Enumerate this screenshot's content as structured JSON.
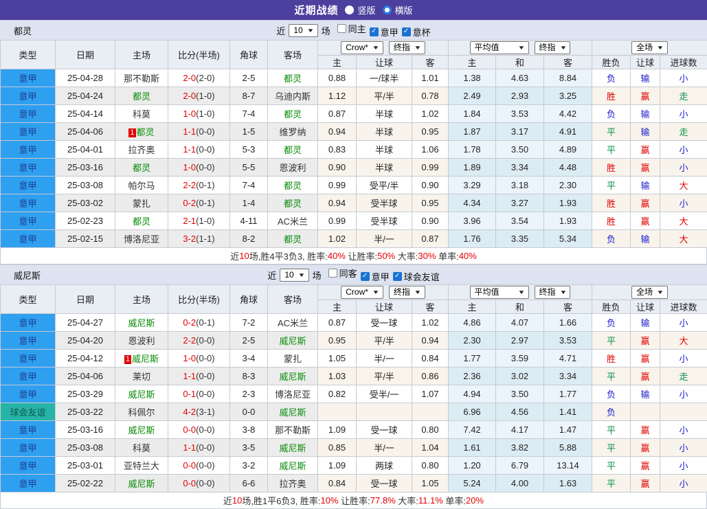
{
  "titlebar": {
    "title": "近期战绩",
    "radios": [
      {
        "label": "竖版",
        "selected": false
      },
      {
        "label": "横版",
        "selected": true
      }
    ]
  },
  "colors": {
    "titlebar_purple": "#4c3f9e",
    "league_blue": "#2f9ff0",
    "friendly_teal": "#27b4a8",
    "win_red": "#e30000",
    "lose_blue": "#1a1acc",
    "draw_green": "#089148",
    "hot_team_green": "#088b08",
    "avg_col_tint": "#ebf4fa"
  },
  "filter_words": {
    "near": "近",
    "games": "场"
  },
  "columns": {
    "type": "类型",
    "date": "日期",
    "home": "主场",
    "score": "比分(半场)",
    "corner": "角球",
    "away": "客场",
    "dd_crow": "Crow*",
    "dd_final": "终指",
    "dd_avg": "平均值",
    "dd_full": "全场",
    "sub": [
      "主",
      "让球",
      "客",
      "主",
      "和",
      "客",
      "胜负",
      "让球",
      "进球数"
    ]
  },
  "sections": [
    {
      "team": "都灵",
      "filter": {
        "count": "10",
        "checks": [
          {
            "label": "同主",
            "state": "unchecked"
          },
          {
            "label": "意甲",
            "state": "checked"
          },
          {
            "label": "意杯",
            "state": "checked"
          }
        ]
      },
      "rows": [
        {
          "type": "意甲",
          "typeKind": "league",
          "date": "25-04-28",
          "badge": "",
          "home": "那不勒斯",
          "homeClass": "",
          "score": "2-0",
          "half": "(2-0)",
          "corner": "2-5",
          "away": "都灵",
          "awayClass": "hot",
          "o1": "0.88",
          "hcap": "一/球半",
          "o2": "1.01",
          "a1": "1.38",
          "a2": "4.63",
          "a3": "8.84",
          "r1": "负",
          "r1k": "lose",
          "r2": "输",
          "r2k": "lose",
          "r3": "小",
          "r3k": "lose"
        },
        {
          "type": "意甲",
          "typeKind": "league",
          "date": "25-04-24",
          "badge": "",
          "home": "都灵",
          "homeClass": "hot",
          "score": "2-0",
          "half": "(1-0)",
          "corner": "8-7",
          "away": "乌迪内斯",
          "awayClass": "",
          "o1": "1.12",
          "hcap": "平/半",
          "o2": "0.78",
          "a1": "2.49",
          "a2": "2.93",
          "a3": "3.25",
          "r1": "胜",
          "r1k": "win",
          "r2": "赢",
          "r2k": "win",
          "r3": "走",
          "r3k": "draw"
        },
        {
          "type": "意甲",
          "typeKind": "league",
          "date": "25-04-14",
          "badge": "",
          "home": "科莫",
          "homeClass": "",
          "score": "1-0",
          "half": "(1-0)",
          "corner": "7-4",
          "away": "都灵",
          "awayClass": "hot",
          "o1": "0.87",
          "hcap": "半球",
          "o2": "1.02",
          "a1": "1.84",
          "a2": "3.53",
          "a3": "4.42",
          "r1": "负",
          "r1k": "lose",
          "r2": "输",
          "r2k": "lose",
          "r3": "小",
          "r3k": "lose"
        },
        {
          "type": "意甲",
          "typeKind": "league",
          "date": "25-04-06",
          "badge": "1",
          "home": "都灵",
          "homeClass": "hot",
          "score": "1-1",
          "half": "(0-0)",
          "corner": "1-5",
          "away": "维罗纳",
          "awayClass": "",
          "o1": "0.94",
          "hcap": "半球",
          "o2": "0.95",
          "a1": "1.87",
          "a2": "3.17",
          "a3": "4.91",
          "r1": "平",
          "r1k": "draw",
          "r2": "输",
          "r2k": "lose",
          "r3": "走",
          "r3k": "draw"
        },
        {
          "type": "意甲",
          "typeKind": "league",
          "date": "25-04-01",
          "badge": "",
          "home": "拉齐奥",
          "homeClass": "",
          "score": "1-1",
          "half": "(0-0)",
          "corner": "5-3",
          "away": "都灵",
          "awayClass": "hot",
          "o1": "0.83",
          "hcap": "半球",
          "o2": "1.06",
          "a1": "1.78",
          "a2": "3.50",
          "a3": "4.89",
          "r1": "平",
          "r1k": "draw",
          "r2": "赢",
          "r2k": "win",
          "r3": "小",
          "r3k": "lose"
        },
        {
          "type": "意甲",
          "typeKind": "league",
          "date": "25-03-16",
          "badge": "",
          "home": "都灵",
          "homeClass": "hot",
          "score": "1-0",
          "half": "(0-0)",
          "corner": "5-5",
          "away": "恩波利",
          "awayClass": "",
          "o1": "0.90",
          "hcap": "半球",
          "o2": "0.99",
          "a1": "1.89",
          "a2": "3.34",
          "a3": "4.48",
          "r1": "胜",
          "r1k": "win",
          "r2": "赢",
          "r2k": "win",
          "r3": "小",
          "r3k": "lose"
        },
        {
          "type": "意甲",
          "typeKind": "league",
          "date": "25-03-08",
          "badge": "",
          "home": "帕尔马",
          "homeClass": "",
          "score": "2-2",
          "half": "(0-1)",
          "corner": "7-4",
          "away": "都灵",
          "awayClass": "hot",
          "o1": "0.99",
          "hcap": "受平/半",
          "o2": "0.90",
          "a1": "3.29",
          "a2": "3.18",
          "a3": "2.30",
          "r1": "平",
          "r1k": "draw",
          "r2": "输",
          "r2k": "lose",
          "r3": "大",
          "r3k": "win"
        },
        {
          "type": "意甲",
          "typeKind": "league",
          "date": "25-03-02",
          "badge": "",
          "home": "蒙扎",
          "homeClass": "",
          "score": "0-2",
          "half": "(0-1)",
          "corner": "1-4",
          "away": "都灵",
          "awayClass": "hot",
          "o1": "0.94",
          "hcap": "受半球",
          "o2": "0.95",
          "a1": "4.34",
          "a2": "3.27",
          "a3": "1.93",
          "r1": "胜",
          "r1k": "win",
          "r2": "赢",
          "r2k": "win",
          "r3": "小",
          "r3k": "lose"
        },
        {
          "type": "意甲",
          "typeKind": "league",
          "date": "25-02-23",
          "badge": "",
          "home": "都灵",
          "homeClass": "hot",
          "score": "2-1",
          "half": "(1-0)",
          "corner": "4-11",
          "away": "AC米兰",
          "awayClass": "",
          "o1": "0.99",
          "hcap": "受半球",
          "o2": "0.90",
          "a1": "3.96",
          "a2": "3.54",
          "a3": "1.93",
          "r1": "胜",
          "r1k": "win",
          "r2": "赢",
          "r2k": "win",
          "r3": "大",
          "r3k": "win"
        },
        {
          "type": "意甲",
          "typeKind": "league",
          "date": "25-02-15",
          "badge": "",
          "home": "博洛尼亚",
          "homeClass": "",
          "score": "3-2",
          "half": "(1-1)",
          "corner": "8-2",
          "away": "都灵",
          "awayClass": "hot",
          "o1": "1.02",
          "hcap": "半/一",
          "o2": "0.87",
          "a1": "1.76",
          "a2": "3.35",
          "a3": "5.34",
          "r1": "负",
          "r1k": "lose",
          "r2": "输",
          "r2k": "lose",
          "r3": "大",
          "r3k": "win"
        }
      ],
      "summary": [
        {
          "t": "近",
          "c": ""
        },
        {
          "t": "10",
          "c": "r"
        },
        {
          "t": "场,胜4平3负3, 胜率:",
          "c": ""
        },
        {
          "t": "40%",
          "c": "r"
        },
        {
          "t": " 让胜率:",
          "c": ""
        },
        {
          "t": "50%",
          "c": "r"
        },
        {
          "t": " 大率:",
          "c": ""
        },
        {
          "t": "30%",
          "c": "r"
        },
        {
          "t": " 单率:",
          "c": ""
        },
        {
          "t": "40%",
          "c": "r"
        }
      ]
    },
    {
      "team": "威尼斯",
      "filter": {
        "count": "10",
        "checks": [
          {
            "label": "同客",
            "state": "unchecked"
          },
          {
            "label": "意甲",
            "state": "checked"
          },
          {
            "label": "球会友谊",
            "state": "checked"
          }
        ]
      },
      "rows": [
        {
          "type": "意甲",
          "typeKind": "league",
          "date": "25-04-27",
          "badge": "",
          "home": "威尼斯",
          "homeClass": "hot",
          "score": "0-2",
          "half": "(0-1)",
          "corner": "7-2",
          "away": "AC米兰",
          "awayClass": "",
          "o1": "0.87",
          "hcap": "受一球",
          "o2": "1.02",
          "a1": "4.86",
          "a2": "4.07",
          "a3": "1.66",
          "r1": "负",
          "r1k": "lose",
          "r2": "输",
          "r2k": "lose",
          "r3": "小",
          "r3k": "lose"
        },
        {
          "type": "意甲",
          "typeKind": "league",
          "date": "25-04-20",
          "badge": "",
          "home": "恩波利",
          "homeClass": "",
          "score": "2-2",
          "half": "(0-0)",
          "corner": "2-5",
          "away": "威尼斯",
          "awayClass": "hot",
          "o1": "0.95",
          "hcap": "平/半",
          "o2": "0.94",
          "a1": "2.30",
          "a2": "2.97",
          "a3": "3.53",
          "r1": "平",
          "r1k": "draw",
          "r2": "赢",
          "r2k": "win",
          "r3": "大",
          "r3k": "win"
        },
        {
          "type": "意甲",
          "typeKind": "league",
          "date": "25-04-12",
          "badge": "1",
          "home": "威尼斯",
          "homeClass": "hot",
          "score": "1-0",
          "half": "(0-0)",
          "corner": "3-4",
          "away": "蒙扎",
          "awayClass": "",
          "o1": "1.05",
          "hcap": "半/一",
          "o2": "0.84",
          "a1": "1.77",
          "a2": "3.59",
          "a3": "4.71",
          "r1": "胜",
          "r1k": "win",
          "r2": "赢",
          "r2k": "win",
          "r3": "小",
          "r3k": "lose"
        },
        {
          "type": "意甲",
          "typeKind": "league",
          "date": "25-04-06",
          "badge": "",
          "home": "莱切",
          "homeClass": "",
          "score": "1-1",
          "half": "(0-0)",
          "corner": "8-3",
          "away": "威尼斯",
          "awayClass": "hot",
          "o1": "1.03",
          "hcap": "平/半",
          "o2": "0.86",
          "a1": "2.36",
          "a2": "3.02",
          "a3": "3.34",
          "r1": "平",
          "r1k": "draw",
          "r2": "赢",
          "r2k": "win",
          "r3": "走",
          "r3k": "draw"
        },
        {
          "type": "意甲",
          "typeKind": "league",
          "date": "25-03-29",
          "badge": "",
          "home": "威尼斯",
          "homeClass": "hot",
          "score": "0-1",
          "half": "(0-0)",
          "corner": "2-3",
          "away": "博洛尼亚",
          "awayClass": "",
          "o1": "0.82",
          "hcap": "受半/一",
          "o2": "1.07",
          "a1": "4.94",
          "a2": "3.50",
          "a3": "1.77",
          "r1": "负",
          "r1k": "lose",
          "r2": "输",
          "r2k": "lose",
          "r3": "小",
          "r3k": "lose"
        },
        {
          "type": "球会友谊",
          "typeKind": "friendly",
          "date": "25-03-22",
          "badge": "",
          "home": "科佩尔",
          "homeClass": "",
          "score": "4-2",
          "half": "(3-1)",
          "corner": "0-0",
          "away": "威尼斯",
          "awayClass": "hot",
          "o1": "",
          "hcap": "",
          "o2": "",
          "a1": "6.96",
          "a2": "4.56",
          "a3": "1.41",
          "r1": "负",
          "r1k": "lose",
          "r2": "",
          "r2k": "",
          "r3": "",
          "r3k": ""
        },
        {
          "type": "意甲",
          "typeKind": "league",
          "date": "25-03-16",
          "badge": "",
          "home": "威尼斯",
          "homeClass": "hot",
          "score": "0-0",
          "half": "(0-0)",
          "corner": "3-8",
          "away": "那不勒斯",
          "awayClass": "",
          "o1": "1.09",
          "hcap": "受一球",
          "o2": "0.80",
          "a1": "7.42",
          "a2": "4.17",
          "a3": "1.47",
          "r1": "平",
          "r1k": "draw",
          "r2": "赢",
          "r2k": "win",
          "r3": "小",
          "r3k": "lose"
        },
        {
          "type": "意甲",
          "typeKind": "league",
          "date": "25-03-08",
          "badge": "",
          "home": "科莫",
          "homeClass": "",
          "score": "1-1",
          "half": "(0-0)",
          "corner": "3-5",
          "away": "威尼斯",
          "awayClass": "hot",
          "o1": "0.85",
          "hcap": "半/一",
          "o2": "1.04",
          "a1": "1.61",
          "a2": "3.82",
          "a3": "5.88",
          "r1": "平",
          "r1k": "draw",
          "r2": "赢",
          "r2k": "win",
          "r3": "小",
          "r3k": "lose"
        },
        {
          "type": "意甲",
          "typeKind": "league",
          "date": "25-03-01",
          "badge": "",
          "home": "亚特兰大",
          "homeClass": "",
          "score": "0-0",
          "half": "(0-0)",
          "corner": "3-2",
          "away": "威尼斯",
          "awayClass": "hot",
          "o1": "1.09",
          "hcap": "两球",
          "o2": "0.80",
          "a1": "1.20",
          "a2": "6.79",
          "a3": "13.14",
          "r1": "平",
          "r1k": "draw",
          "r2": "赢",
          "r2k": "win",
          "r3": "小",
          "r3k": "lose"
        },
        {
          "type": "意甲",
          "typeKind": "league",
          "date": "25-02-22",
          "badge": "",
          "home": "威尼斯",
          "homeClass": "hot",
          "score": "0-0",
          "half": "(0-0)",
          "corner": "6-6",
          "away": "拉齐奥",
          "awayClass": "",
          "o1": "0.84",
          "hcap": "受一球",
          "o2": "1.05",
          "a1": "5.24",
          "a2": "4.00",
          "a3": "1.63",
          "r1": "平",
          "r1k": "draw",
          "r2": "赢",
          "r2k": "win",
          "r3": "小",
          "r3k": "lose"
        }
      ],
      "summary": [
        {
          "t": "近",
          "c": ""
        },
        {
          "t": "10",
          "c": "r"
        },
        {
          "t": "场,胜1平6负3, 胜率:",
          "c": ""
        },
        {
          "t": "10%",
          "c": "r"
        },
        {
          "t": " 让胜率:",
          "c": ""
        },
        {
          "t": "77.8%",
          "c": "r"
        },
        {
          "t": " 大率:",
          "c": ""
        },
        {
          "t": "11.1%",
          "c": "r"
        },
        {
          "t": " 单率:",
          "c": ""
        },
        {
          "t": "20%",
          "c": "r"
        }
      ]
    }
  ]
}
